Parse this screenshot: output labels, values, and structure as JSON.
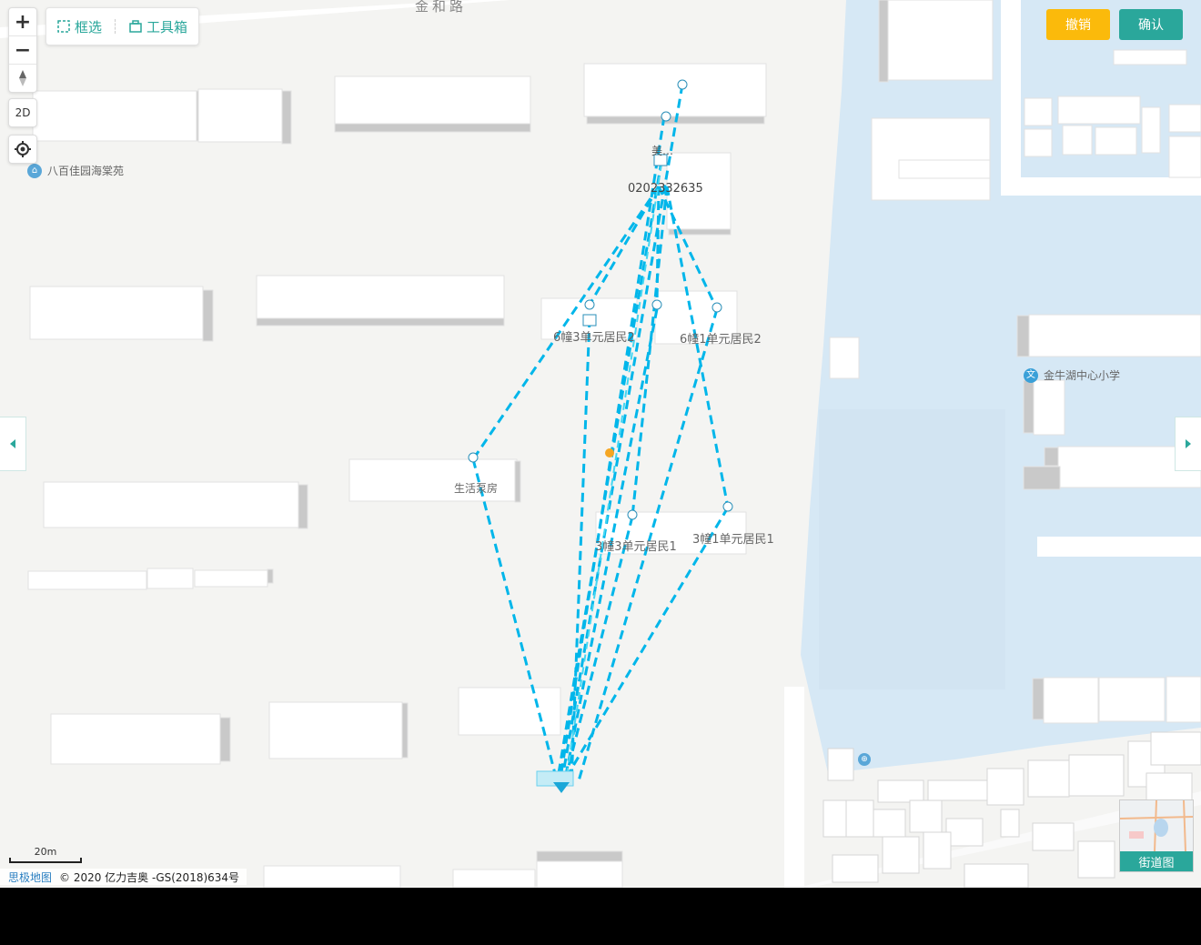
{
  "toolbar": {
    "select_label": "框选",
    "toolbox_label": "工具箱"
  },
  "zoom": {
    "in_label": "+",
    "out_label": "−",
    "mode_2d_label": "2D"
  },
  "actions": {
    "cancel_label": "撤销",
    "confirm_label": "确认",
    "cancel_color": "#fbba0b",
    "confirm_color": "#2aa79b"
  },
  "map": {
    "road_name": "金和路",
    "pois": [
      {
        "name": "八百佳园海棠苑",
        "icon": "home-poi-icon"
      },
      {
        "name": "金牛湖中心小学",
        "icon": "school-poi-icon"
      }
    ],
    "water_color": "#d6e8f5",
    "line_color": "#00b6ea"
  },
  "network": {
    "node_labels": {
      "source_id": "0202332635",
      "source_short": "美…",
      "resident_6_3_2": "6幢3单元居民2",
      "resident_6_1_2": "6幢1单元居民2",
      "pump_room": "生活泵房",
      "resident_3_3_1": "3幢3单元居民1",
      "resident_3_1_1": "3幢1单元居民1"
    }
  },
  "scale": {
    "label": "20m"
  },
  "attribution": {
    "brand": "思极地图",
    "copyright": "© 2020 亿力吉奥 -GS(2018)634号"
  },
  "minimap": {
    "label": "街道图"
  },
  "side_nav": {
    "left_icon": "chevron-left-icon",
    "right_icon": "chevron-right-icon"
  }
}
